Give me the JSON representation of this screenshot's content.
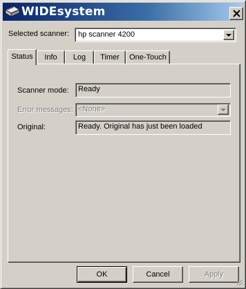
{
  "window": {
    "title": "WIDEsystem",
    "icon": "scanner-icon",
    "close_icon": "close-icon"
  },
  "scanner": {
    "label": "Selected scanner:",
    "selected": "hp scanner 4200"
  },
  "tabs": [
    {
      "label": "Status",
      "active": true
    },
    {
      "label": "Info",
      "active": false
    },
    {
      "label": "Log",
      "active": false
    },
    {
      "label": "Timer",
      "active": false
    },
    {
      "label": "One-Touch",
      "active": false
    }
  ],
  "status": {
    "mode_label": "Scanner mode:",
    "mode_value": "Ready",
    "errors_label": "Error messages:",
    "errors_value": "<None>",
    "original_label": "Original:",
    "original_value": "Ready. Original has just been loaded"
  },
  "buttons": {
    "ok": "OK",
    "cancel": "Cancel",
    "apply": "Apply"
  },
  "colors": {
    "title_start": "#0a246a",
    "title_end": "#a6caf0",
    "face": "#d4d0c8"
  }
}
